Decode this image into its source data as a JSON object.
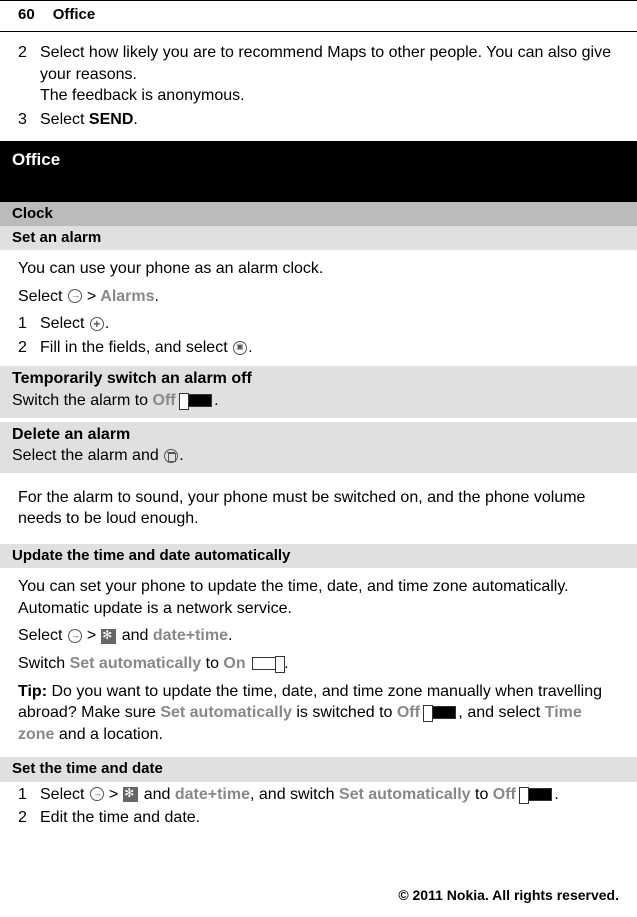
{
  "header": {
    "pageNum": "60",
    "section": "Office"
  },
  "intro": {
    "step2_num": "2",
    "step2_text1": "Select how likely you are to recommend Maps to other people. You can also give your reasons.",
    "step2_text2": "The feedback is anonymous.",
    "step3_num": "3",
    "step3_prefix": "Select ",
    "step3_bold": "SEND",
    "step3_suffix": "."
  },
  "office_heading": "Office",
  "clock_heading": "Clock",
  "set_alarm": {
    "title": "Set an alarm",
    "intro": "You can use your phone as an alarm clock.",
    "select_prefix": "Select ",
    "gt": ">",
    "alarms": "Alarms",
    "dot": ".",
    "s1_num": "1",
    "s1_prefix": "Select ",
    "s1_suffix": ".",
    "s2_num": "2",
    "s2_prefix": "Fill in the fields, and select ",
    "s2_suffix": "."
  },
  "temp_off": {
    "title": "Temporarily switch an alarm off",
    "prefix": "Switch the alarm to ",
    "off": "Off",
    "suffix": "."
  },
  "delete_alarm": {
    "title": "Delete an alarm",
    "prefix": "Select the alarm and ",
    "suffix": "."
  },
  "alarm_note": "For the alarm to sound, your phone must be switched on, and the phone volume needs to be loud enough.",
  "auto_time": {
    "title": "Update the time and date automatically",
    "intro": "You can set your phone to update the time, date, and time zone automatically. Automatic update is a network service.",
    "select_prefix": "Select ",
    "gt": ">",
    "and": " and ",
    "datetime": "date+time",
    "dot": ".",
    "switch_prefix": "Switch ",
    "set_auto": "Set automatically",
    "to": " to ",
    "on": "On",
    "tip_label": "Tip:",
    "tip_1": " Do you want to update the time, date, and time zone manually when travelling abroad? Make sure ",
    "tip_2": " is switched to ",
    "off": "Off",
    "tip_3": ", and select ",
    "timezone": "Time zone",
    "tip_4": " and a location."
  },
  "set_time": {
    "title": "Set the time and date",
    "s1_num": "1",
    "s1_prefix": "Select ",
    "gt": ">",
    "and": " and ",
    "datetime": "date+time",
    "s1_mid": ", and switch ",
    "set_auto": "Set automatically",
    "to": " to ",
    "off": "Off",
    "s1_suffix": ".",
    "s2_num": "2",
    "s2_text": "Edit the time and date."
  },
  "footer": "© 2011 Nokia. All rights reserved."
}
